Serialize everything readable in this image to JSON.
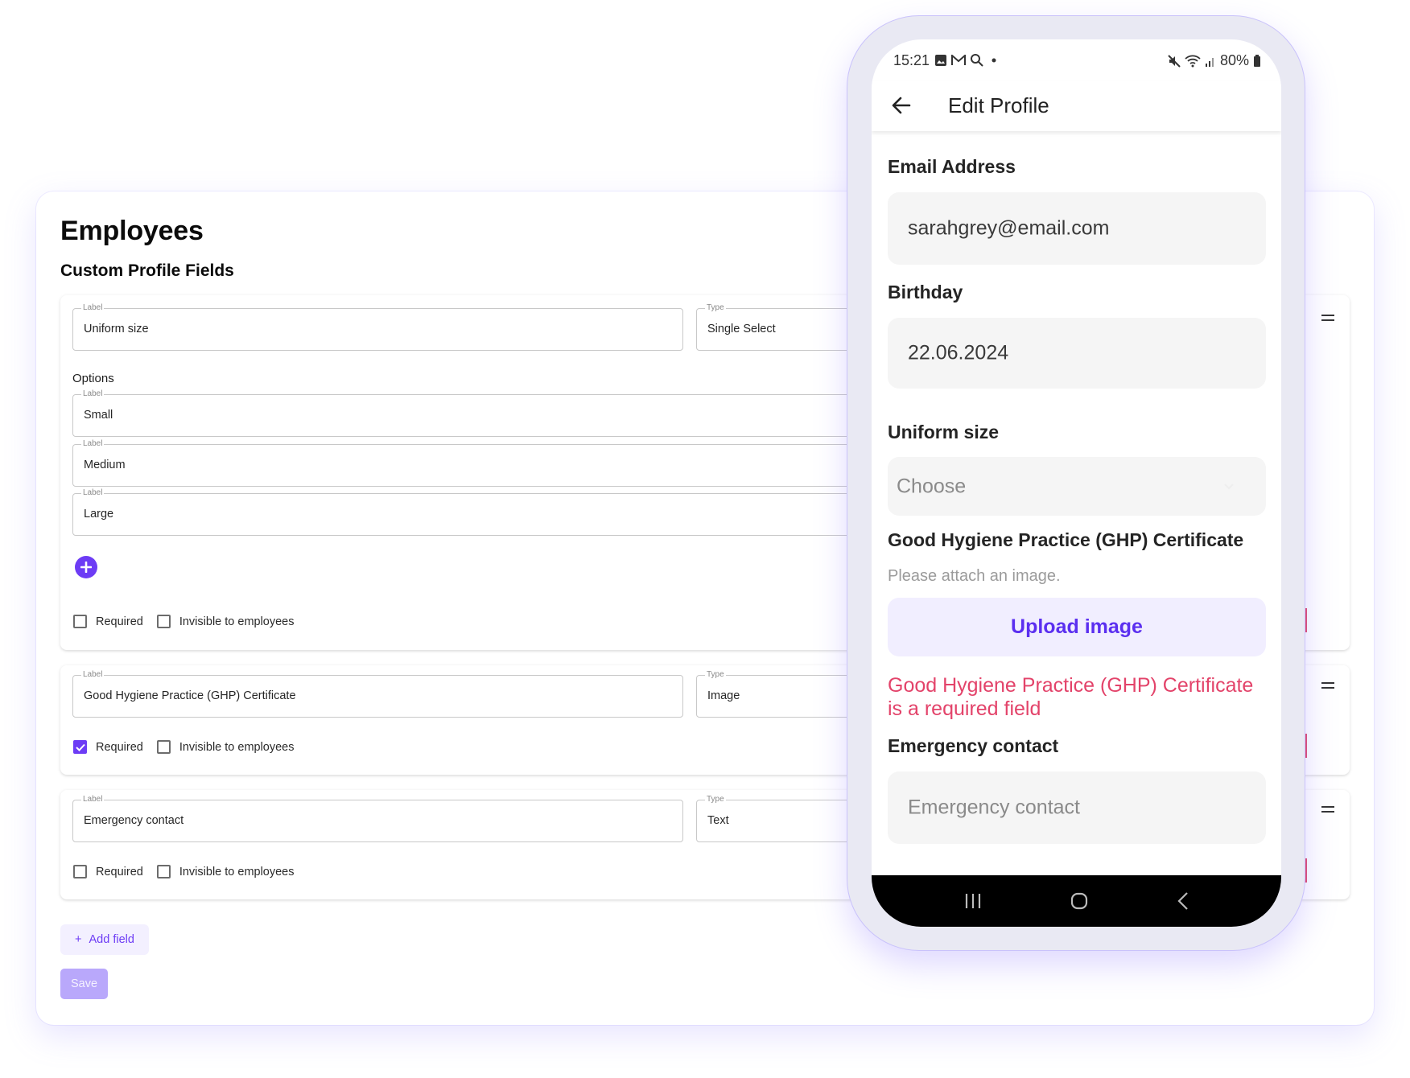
{
  "admin": {
    "page_title": "Employees",
    "section_title": "Custom Profile Fields",
    "label_legend": "Label",
    "type_legend": "Type",
    "options_label": "Options",
    "fields": [
      {
        "label": "Uniform size",
        "type": "Single Select",
        "options": [
          "Small",
          "Medium",
          "Large"
        ],
        "required": false,
        "invisible": false
      },
      {
        "label": "Good Hygiene Practice (GHP) Certificate",
        "type": "Image",
        "required": true,
        "invisible": false
      },
      {
        "label": "Emergency contact",
        "type": "Text",
        "required": false,
        "invisible": false
      }
    ],
    "required_label": "Required",
    "invisible_label": "Invisible to employees",
    "add_option_icon": "plus-circle-icon",
    "add_field_icon": "+",
    "add_field_label": "Add field",
    "save_label": "Save",
    "accent_color": "#6d3cf5",
    "danger_color": "#e0466b"
  },
  "phone": {
    "status": {
      "time": "15:21",
      "left_icons": [
        "gallery-icon",
        "gmail-icon",
        "location-icon",
        "dot"
      ],
      "right_icons": [
        "mute-icon",
        "wifi-icon",
        "signal-icon"
      ],
      "battery": "80%"
    },
    "appbar": {
      "title": "Edit Profile",
      "back_icon": "arrow-left-icon"
    },
    "form": {
      "email_label": "Email Address",
      "email_value": "sarahgrey@email.com",
      "birthday_label": "Birthday",
      "birthday_value": "22.06.2024",
      "uniform_label": "Uniform size",
      "uniform_placeholder": "Choose",
      "ghp_label": "Good Hygiene Practice (GHP) Certificate",
      "ghp_help": "Please attach an image.",
      "upload_label": "Upload image",
      "ghp_error_line1": "Good Hygiene Practice (GHP) Certificate",
      "ghp_error_line2": "is a required field",
      "emergency_label": "Emergency contact",
      "emergency_placeholder": "Emergency contact"
    },
    "nav": [
      "recents-icon",
      "home-icon",
      "back-icon"
    ]
  }
}
